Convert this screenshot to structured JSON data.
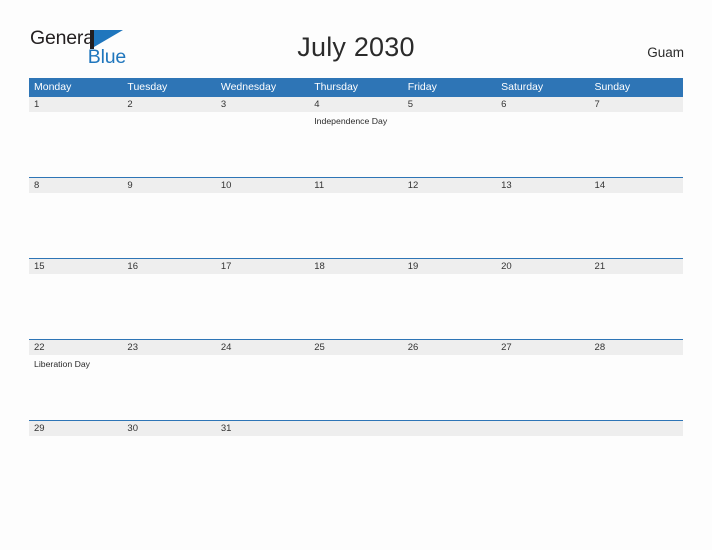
{
  "brand": {
    "name_part1": "General",
    "name_part2": "Blue",
    "flag_icon": "flag-icon",
    "accent_color": "#1f76bd"
  },
  "header": {
    "title": "July 2030",
    "locale": "Guam"
  },
  "calendar": {
    "month": "July",
    "year": "2030",
    "header_color": "#2e75b6",
    "band_color": "#eeeeee",
    "weekdays": [
      "Monday",
      "Tuesday",
      "Wednesday",
      "Thursday",
      "Friday",
      "Saturday",
      "Sunday"
    ],
    "weeks": [
      {
        "days": [
          {
            "date": "1",
            "event": ""
          },
          {
            "date": "2",
            "event": ""
          },
          {
            "date": "3",
            "event": ""
          },
          {
            "date": "4",
            "event": "Independence Day"
          },
          {
            "date": "5",
            "event": ""
          },
          {
            "date": "6",
            "event": ""
          },
          {
            "date": "7",
            "event": ""
          }
        ]
      },
      {
        "days": [
          {
            "date": "8",
            "event": ""
          },
          {
            "date": "9",
            "event": ""
          },
          {
            "date": "10",
            "event": ""
          },
          {
            "date": "11",
            "event": ""
          },
          {
            "date": "12",
            "event": ""
          },
          {
            "date": "13",
            "event": ""
          },
          {
            "date": "14",
            "event": ""
          }
        ]
      },
      {
        "days": [
          {
            "date": "15",
            "event": ""
          },
          {
            "date": "16",
            "event": ""
          },
          {
            "date": "17",
            "event": ""
          },
          {
            "date": "18",
            "event": ""
          },
          {
            "date": "19",
            "event": ""
          },
          {
            "date": "20",
            "event": ""
          },
          {
            "date": "21",
            "event": ""
          }
        ]
      },
      {
        "days": [
          {
            "date": "22",
            "event": "Liberation Day"
          },
          {
            "date": "23",
            "event": ""
          },
          {
            "date": "24",
            "event": ""
          },
          {
            "date": "25",
            "event": ""
          },
          {
            "date": "26",
            "event": ""
          },
          {
            "date": "27",
            "event": ""
          },
          {
            "date": "28",
            "event": ""
          }
        ]
      },
      {
        "days": [
          {
            "date": "29",
            "event": ""
          },
          {
            "date": "30",
            "event": ""
          },
          {
            "date": "31",
            "event": ""
          },
          {
            "date": "",
            "event": ""
          },
          {
            "date": "",
            "event": ""
          },
          {
            "date": "",
            "event": ""
          },
          {
            "date": "",
            "event": ""
          }
        ]
      }
    ]
  }
}
